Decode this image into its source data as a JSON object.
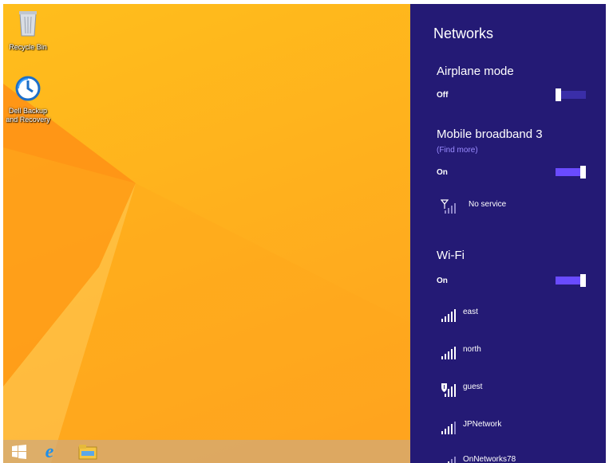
{
  "desktop": {
    "icons": [
      {
        "label": "Recycle Bin",
        "icon": "recycle-bin-icon"
      },
      {
        "label": "Dell Backup and Recovery",
        "icon": "dell-backup-icon"
      }
    ]
  },
  "taskbar": {
    "items": [
      {
        "icon": "windows-start-icon"
      },
      {
        "icon": "internet-explorer-icon"
      },
      {
        "icon": "file-explorer-icon"
      }
    ]
  },
  "panel": {
    "title": "Networks",
    "airplane": {
      "title": "Airplane mode",
      "state": "Off",
      "on": false
    },
    "mobile": {
      "title": "Mobile broadband 3",
      "link": "(Find more)",
      "state": "On",
      "on": true,
      "network": {
        "name": "No service",
        "icon": "no-service-signal-icon"
      }
    },
    "wifi": {
      "title": "Wi-Fi",
      "state": "On",
      "on": true,
      "networks": [
        {
          "name": "east",
          "icon": "wifi-signal-icon"
        },
        {
          "name": "north",
          "icon": "wifi-signal-icon"
        },
        {
          "name": "guest",
          "icon": "wifi-shield-signal-icon"
        },
        {
          "name": "JPNetwork",
          "icon": "wifi-signal-icon"
        },
        {
          "name": "OnNetworks78",
          "icon": "wifi-signal-icon"
        }
      ]
    }
  },
  "colors": {
    "panel_bg": "#241a75",
    "toggle_on": "#6a4bff",
    "link": "#9b8cff",
    "desktop": "#ffb11d"
  }
}
